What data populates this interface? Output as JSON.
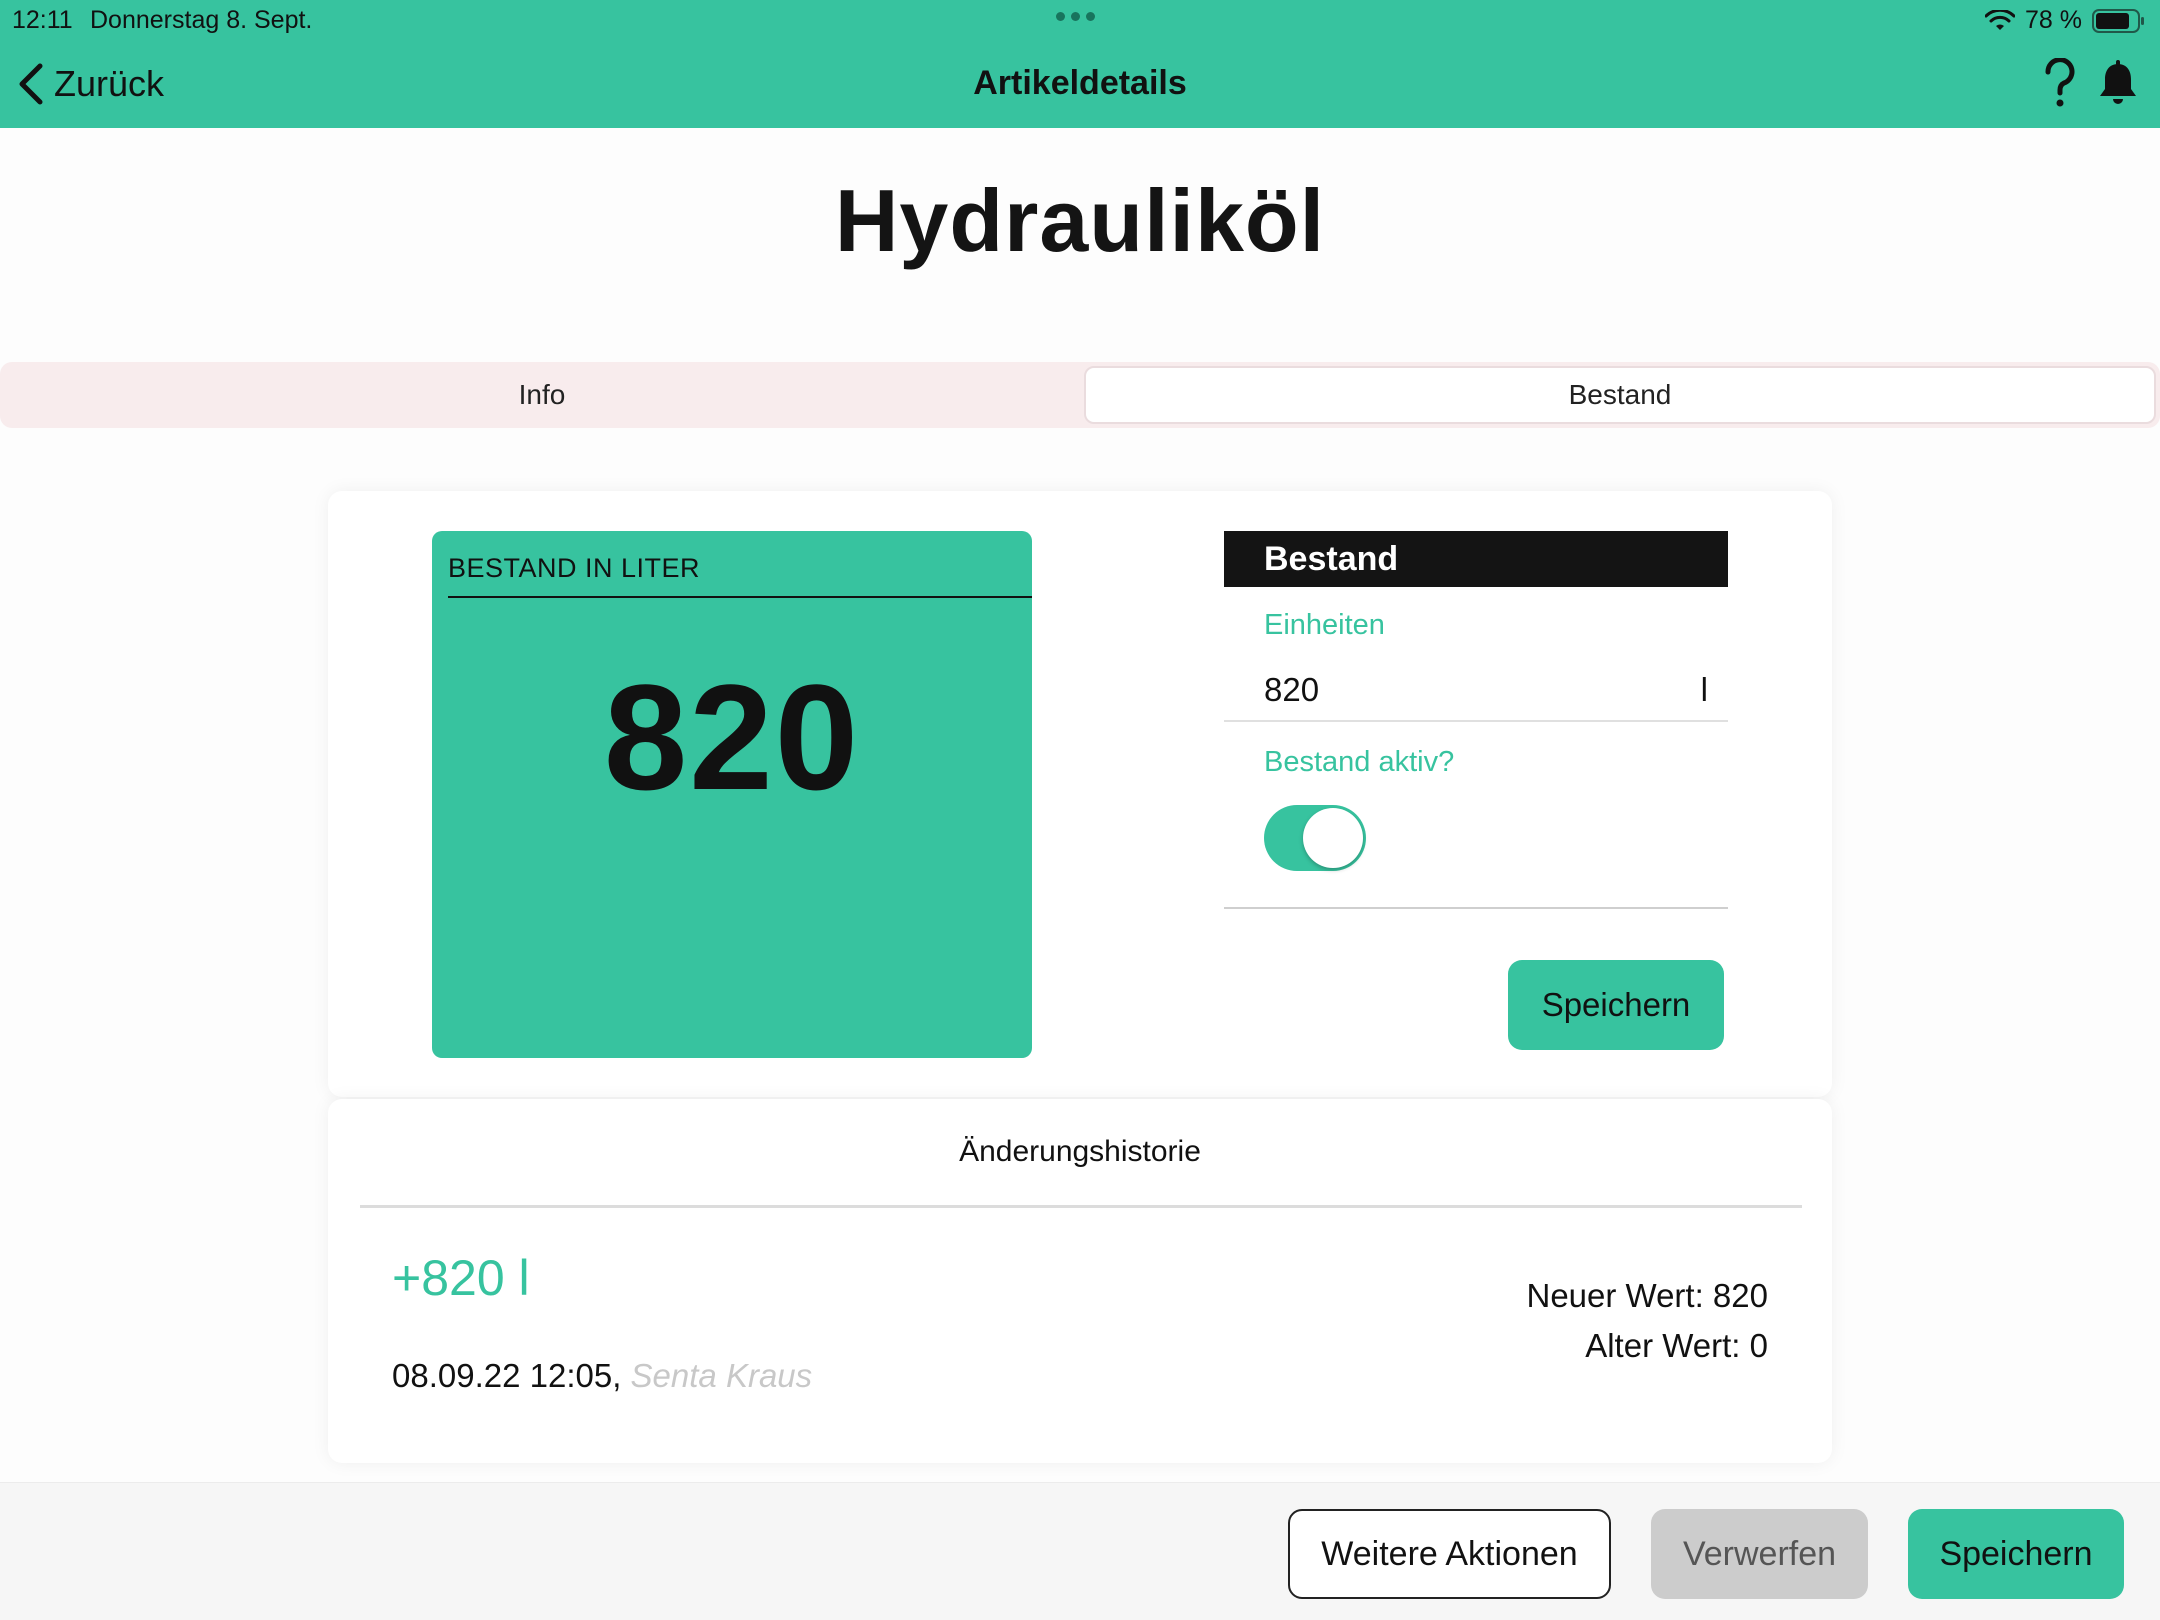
{
  "status_bar": {
    "time": "12:11",
    "date": "Donnerstag 8. Sept.",
    "battery": "78 %"
  },
  "nav": {
    "back_label": "Zurück",
    "title": "Artikeldetails"
  },
  "product": {
    "name": "Hydrauliköl"
  },
  "tabs": [
    {
      "label": "Info",
      "selected": false
    },
    {
      "label": "Bestand",
      "selected": true
    }
  ],
  "stock_tile": {
    "header": "BESTAND IN LITER",
    "value": "820"
  },
  "stock_form": {
    "header": "Bestand",
    "units_label": "Einheiten",
    "units_value": "820",
    "unit": "l",
    "active_label": "Bestand aktiv?",
    "active": true,
    "save_label": "Speichern"
  },
  "history": {
    "title": "Änderungshistorie",
    "entries": [
      {
        "change": "+820 l",
        "timestamp": "08.09.22 12:05,",
        "user": "Senta Kraus",
        "new_value": "Neuer Wert: 820",
        "old_value": "Alter Wert: 0"
      }
    ]
  },
  "footer": {
    "more_actions_label": "Weitere Aktionen",
    "discard_label": "Verwerfen",
    "save_label": "Speichern"
  },
  "colors": {
    "accent": "#37c39f",
    "header_dark": "#141414",
    "tab_background": "#f8eced",
    "discard_gray": "#cccccc"
  },
  "icons": {
    "back": "chevron-left-icon",
    "help": "question-mark-icon",
    "notifications": "bell-icon",
    "wifi": "wifi-icon",
    "battery": "battery-icon"
  }
}
